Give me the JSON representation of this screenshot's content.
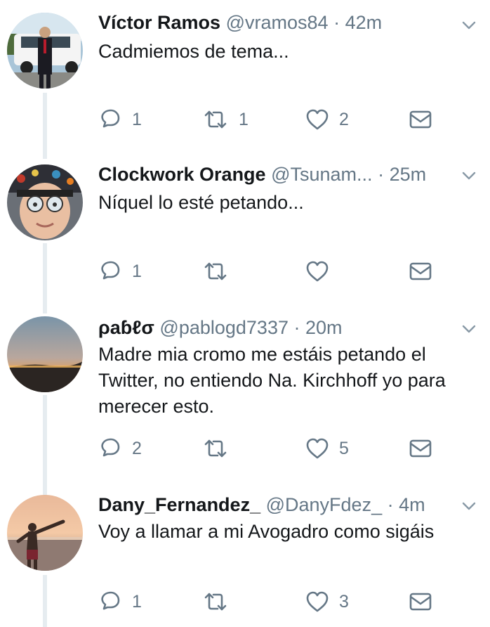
{
  "tweets": [
    {
      "name": "Víctor Ramos",
      "handle": "@vramos84",
      "separator": "·",
      "time": "42m",
      "text": "Cadmiemos de tema...",
      "replies": "1",
      "retweets": "1",
      "likes": "2",
      "avatar_icon": "man-in-suit-with-car-avatar"
    },
    {
      "name": "Clockwork Orange",
      "handle": "@Tsunam...",
      "separator": "·",
      "time": "25m",
      "text": "Níquel lo esté petando...",
      "replies": "1",
      "retweets": "",
      "likes": "",
      "avatar_icon": "face-with-goggles-avatar"
    },
    {
      "name": "ρaɓℓσ",
      "handle": "@pablogd7337",
      "separator": "·",
      "time": "20m",
      "text": "Madre mia cromo me estáis petando el Twitter, no entiendo Na. Kirchhoff yo para merecer esto.",
      "replies": "2",
      "retweets": "",
      "likes": "5",
      "avatar_icon": "sunset-landscape-avatar"
    },
    {
      "name": "Dany_Fernandez_",
      "handle": "@DanyFdez_",
      "separator": "·",
      "time": "4m",
      "text": "Voy a llamar a mi Avogadro como sigáis",
      "replies": "1",
      "retweets": "",
      "likes": "3",
      "avatar_icon": "beach-sunset-person-avatar"
    }
  ],
  "colors": {
    "text": "#14171a",
    "secondary": "#657786",
    "thread_line": "#e6ecf0"
  }
}
